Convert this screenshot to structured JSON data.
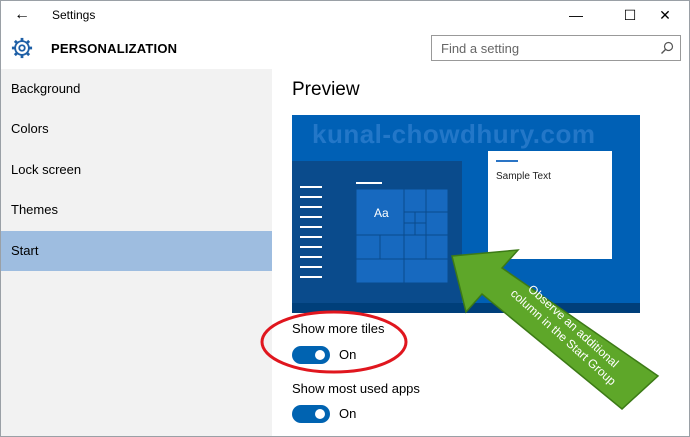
{
  "window": {
    "title": "Settings"
  },
  "header": {
    "heading": "PERSONALIZATION",
    "search_placeholder": "Find a setting"
  },
  "sidebar": {
    "items": [
      {
        "label": "Background"
      },
      {
        "label": "Colors"
      },
      {
        "label": "Lock screen"
      },
      {
        "label": "Themes"
      },
      {
        "label": "Start",
        "selected": true
      }
    ]
  },
  "main": {
    "preview_title": "Preview",
    "preview": {
      "sample_text": "Sample Text",
      "tile_text": "Aa",
      "watermark": "kunal-chowdhury.com"
    },
    "settings": [
      {
        "label": "Show more tiles",
        "state": "On"
      },
      {
        "label": "Show most used apps",
        "state": "On"
      }
    ]
  },
  "annotation": {
    "line1": "Observe an additional",
    "line2": "column in the Start Group"
  },
  "colors": {
    "accent": "#0063b1",
    "selected": "#9ebde0",
    "arrow": "#5ea729",
    "circle": "#e0161e"
  }
}
